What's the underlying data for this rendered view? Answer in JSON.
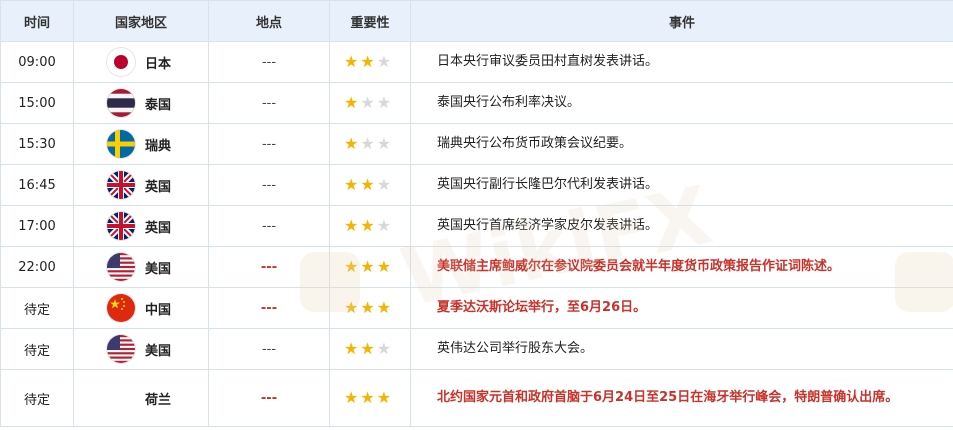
{
  "headers": {
    "time": "时间",
    "country": "国家地区",
    "location": "地点",
    "importance": "重要性",
    "event": "事件"
  },
  "watermark": "WikiFX",
  "rows": [
    {
      "time": "09:00",
      "flag": "japan-flag-icon",
      "country": "日本",
      "location": "---",
      "stars": 2,
      "event": "日本央行审议委员田村直树发表讲话。",
      "highlight": false
    },
    {
      "time": "15:00",
      "flag": "thailand-flag-icon",
      "country": "泰国",
      "location": "---",
      "stars": 1,
      "event": "泰国央行公布利率决议。",
      "highlight": false
    },
    {
      "time": "15:30",
      "flag": "sweden-flag-icon",
      "country": "瑞典",
      "location": "---",
      "stars": 1,
      "event": "瑞典央行公布货币政策会议纪要。",
      "highlight": false
    },
    {
      "time": "16:45",
      "flag": "uk-flag-icon",
      "country": "英国",
      "location": "---",
      "stars": 2,
      "event": "英国央行副行长隆巴尔代利发表讲话。",
      "highlight": false
    },
    {
      "time": "17:00",
      "flag": "uk-flag-icon",
      "country": "英国",
      "location": "---",
      "stars": 2,
      "event": "英国央行首席经济学家皮尔发表讲话。",
      "highlight": false
    },
    {
      "time": "22:00",
      "flag": "us-flag-icon",
      "country": "美国",
      "location": "---",
      "stars": 3,
      "event": "美联储主席鲍威尔在参议院委员会就半年度货币政策报告作证词陈述。",
      "highlight": true
    },
    {
      "time": "待定",
      "flag": "china-flag-icon",
      "country": "中国",
      "location": "---",
      "stars": 3,
      "event": "夏季达沃斯论坛举行，至6月26日。",
      "highlight": true
    },
    {
      "time": "待定",
      "flag": "us-flag-icon",
      "country": "美国",
      "location": "---",
      "stars": 2,
      "event": "英伟达公司举行股东大会。",
      "highlight": false
    },
    {
      "time": "待定",
      "flag": "",
      "country": "荷兰",
      "location": "---",
      "stars": 3,
      "event": "北约国家元首和政府首脑于6月24日至25日在海牙举行峰会，特朗普确认出席。",
      "highlight": true
    }
  ],
  "colors": {
    "header_bg": "#e8f1fb",
    "border": "#d6e2ef",
    "highlight_text": "#c8322a",
    "star_on": "#f5b400",
    "star_off": "#d8d8d8"
  }
}
